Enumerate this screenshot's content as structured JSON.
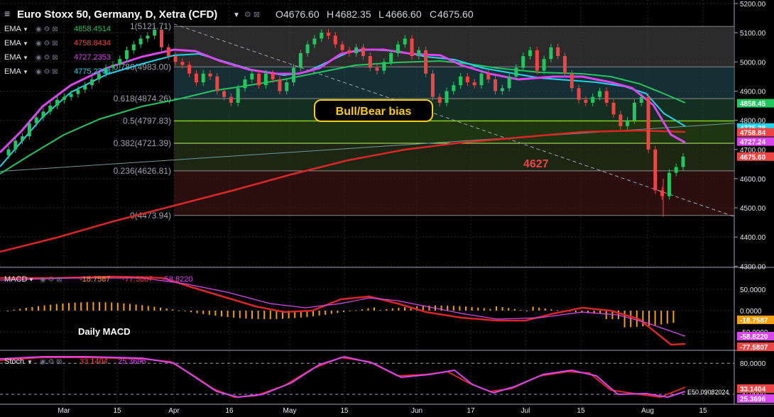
{
  "header": {
    "title": "Euro Stoxx 50, Germany, D, Xetra (CFD)",
    "open_label": "O",
    "open": "4676.60",
    "high_label": "H",
    "high": "4682.35",
    "low_label": "L",
    "low": "4666.60",
    "close_label": "C",
    "close": "4675.60"
  },
  "ema_legend": [
    {
      "name": "EMA",
      "value": "4858.4514",
      "color": "#22c55e"
    },
    {
      "name": "EMA",
      "value": "4758.8434",
      "color": "#ef4444"
    },
    {
      "name": "EMA",
      "value": "4727.2353",
      "color": "#d946ef"
    },
    {
      "name": "EMA",
      "value": "4775.2764",
      "color": "#22d3ee"
    }
  ],
  "fib_levels": [
    {
      "label": "1(5121.71)",
      "value": 5121.71,
      "fill": "#3a3a3a"
    },
    {
      "label": "0.786(4983.00)",
      "value": 4983.0,
      "fill": "#1c3f45"
    },
    {
      "label": "0.618(4874.26)",
      "value": 4874.26,
      "fill": "#1c3d2e"
    },
    {
      "label": "0.5(4797.83)",
      "value": 4797.83,
      "fill": "#2a4616"
    },
    {
      "label": "0.382(4721.39)",
      "value": 4721.39,
      "fill": "#27311a"
    },
    {
      "label": "0.236(4626.81)",
      "value": 4626.81,
      "fill": "#3a1414"
    },
    {
      "label": "0(4473.94)",
      "value": 4473.94,
      "fill": "#2a0c0c"
    }
  ],
  "annotations": {
    "bias_box": "Bull/Bear bias",
    "level_label": "4627",
    "macd_title": "Daily MACD"
  },
  "price_axis": [
    "5200.00",
    "5100.00",
    "5000.00",
    "4900.00",
    "4800.00",
    "4700.00",
    "4600.00",
    "4500.00",
    "4400.00",
    "4300.00"
  ],
  "price_tags": [
    {
      "text": "4858.45",
      "value": 4858.45,
      "color": "#22c55e"
    },
    {
      "text": "4775.28",
      "value": 4775.28,
      "color": "#22d3ee"
    },
    {
      "text": "4758.84",
      "value": 4758.84,
      "color": "#ef4444"
    },
    {
      "text": "4727.24",
      "value": 4727.24,
      "color": "#d946ef"
    },
    {
      "text": "4675.60",
      "value": 4675.6,
      "color": "#ef4444"
    }
  ],
  "macd": {
    "label": "MACD",
    "values": [
      "-18.7587",
      "-77.5807",
      "-58.8220"
    ],
    "axis": [
      "50.0000",
      "0.0000",
      "-50.0000"
    ],
    "tags": [
      {
        "text": "-18.7587",
        "color": "#f59e0b"
      },
      {
        "text": "-58.8220",
        "color": "#d946ef"
      },
      {
        "text": "-77.5807",
        "color": "#ef4444"
      }
    ]
  },
  "stoch": {
    "label": "Stoch",
    "values": [
      "33.1404",
      "25.3696"
    ],
    "axis": [
      "80.0000",
      "20.0000"
    ],
    "tags": [
      {
        "text": "33.1404",
        "color": "#ef4444"
      },
      {
        "text": "25.3696",
        "color": "#d946ef"
      }
    ]
  },
  "x_axis": [
    "Mar",
    "15",
    "Apr",
    "16",
    "May",
    "15",
    "Jun",
    "17",
    "Jul",
    "15",
    "Aug",
    "15"
  ],
  "watermark": "E50 09082024",
  "chart_data": {
    "type": "candlestick",
    "title": "Euro Stoxx 50, Germany, D, Xetra (CFD)",
    "ylim": [
      4300,
      5200
    ],
    "ohlc_close_approx": [
      4700,
      4730,
      4745,
      4790,
      4810,
      4830,
      4850,
      4870,
      4880,
      4890,
      4905,
      4920,
      4940,
      4960,
      4980,
      4990,
      5010,
      5040,
      5060,
      5080,
      5090,
      5110,
      5050,
      5020,
      5000,
      4990,
      4960,
      4930,
      4960,
      4950,
      4900,
      4880,
      4860,
      4910,
      4940,
      4960,
      4920,
      4960,
      4940,
      4900,
      4930,
      4980,
      5030,
      5060,
      5080,
      5100,
      5090,
      5060,
      5040,
      5030,
      5050,
      5020,
      4980,
      4970,
      5000,
      5030,
      5060,
      5080,
      5020,
      5040,
      4960,
      4880,
      4860,
      4900,
      4920,
      4950,
      4930,
      4920,
      4960,
      4940,
      4900,
      4910,
      4950,
      4980,
      5020,
      5040,
      4970,
      5010,
      5050,
      5020,
      4960,
      4910,
      4870,
      4860,
      4880,
      4900,
      4860,
      4820,
      4780,
      4800,
      4860,
      4880,
      4700,
      4560,
      4540,
      4620,
      4640,
      4675.6
    ],
    "ema_final": {
      "green": 4858.4514,
      "red": 4758.8434,
      "magenta": 4727.2353,
      "cyan": 4775.2764
    },
    "macd_final": {
      "histogram": -18.7587,
      "macd": -77.5807,
      "signal": -58.822
    },
    "stoch_final": {
      "k": 33.1404,
      "d": 25.3696
    }
  }
}
